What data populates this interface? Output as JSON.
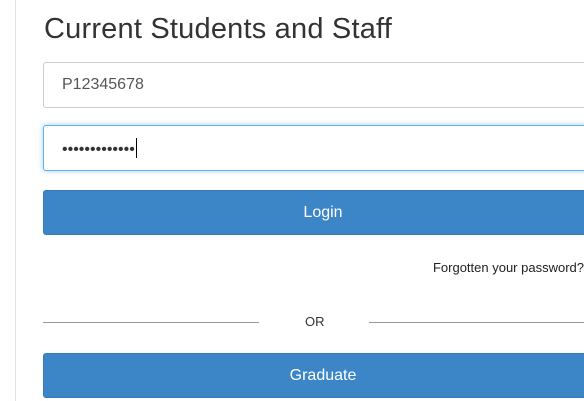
{
  "section": {
    "title": "Current Students and Staff"
  },
  "form": {
    "username_value": "P12345678",
    "password_mask": "•••••••••••••",
    "login_label": "Login",
    "forgot_label": "Forgotten your password?",
    "or_label": "OR",
    "graduate_label": "Graduate"
  },
  "colors": {
    "button_blue": "#3c86c7",
    "focus_border": "#66afe9"
  }
}
